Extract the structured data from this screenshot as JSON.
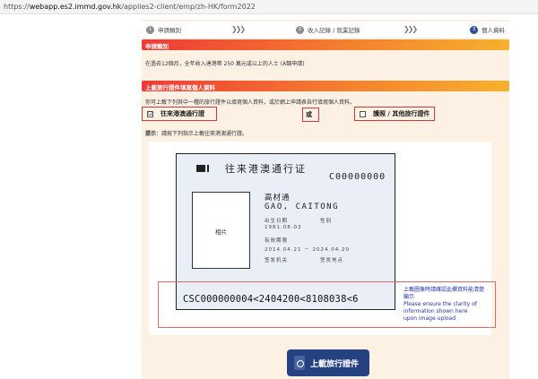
{
  "browser": {
    "url_scheme": "https://",
    "url_host": "webapp.es2.immd.gov.hk",
    "url_path": "/applies2-client/emp/zh-HK/form2022"
  },
  "steps": [
    {
      "num": "1",
      "label": "申請類別"
    },
    {
      "num": "2",
      "label": "收入記錄 / 就業記錄"
    },
    {
      "num": "3",
      "label": "個人資料"
    }
  ],
  "section1": {
    "title": "申請類別",
    "text": "在過去12個月，全年收入達港幣 250 萬元或以上的人士 (A類申請)"
  },
  "section2": {
    "title": "上載旅行證件填寫個人資料",
    "instruction": "你可上載下列其中一種的旅行證件以填寫個人資料，或於網上申請表自行填寫個人資料。",
    "option_mainland": "往來港澳通行證",
    "option_or": "或",
    "option_other": "護照 / 其他旅行證件",
    "checkbox_mark": "☑",
    "hint_label": "提示",
    "hint_text": "：請按下列指示上載往來港澳通行證。"
  },
  "sample_card": {
    "title": "往来港澳通行证",
    "doc_number": "C00000000",
    "photo_label": "相片",
    "name_cn": "高材通",
    "name_en": "GAO, CAITONG",
    "dob_label": "出生日期",
    "sex_label": "性别",
    "dob_value": "1981.08.03",
    "validity_label": "有效期限",
    "validity_value": "2014.04.21 － 2024.04.20",
    "issuer_label": "签发机关",
    "place_label": "签发地点",
    "mrz": "CSC000000004<2404200<8108038<6"
  },
  "note": {
    "zh": "上載圖像時請確認此欄資料能清楚顯示",
    "en1": "Please ensure the clarity of",
    "en2": "information shown here",
    "en3": "upon image upload"
  },
  "upload_button": "上載旅行證件",
  "colors": {
    "accent_blue": "#26417f",
    "bar_red": "#ee3b36",
    "bar_orange": "#f6b12f",
    "note_blue": "#2233aa"
  }
}
